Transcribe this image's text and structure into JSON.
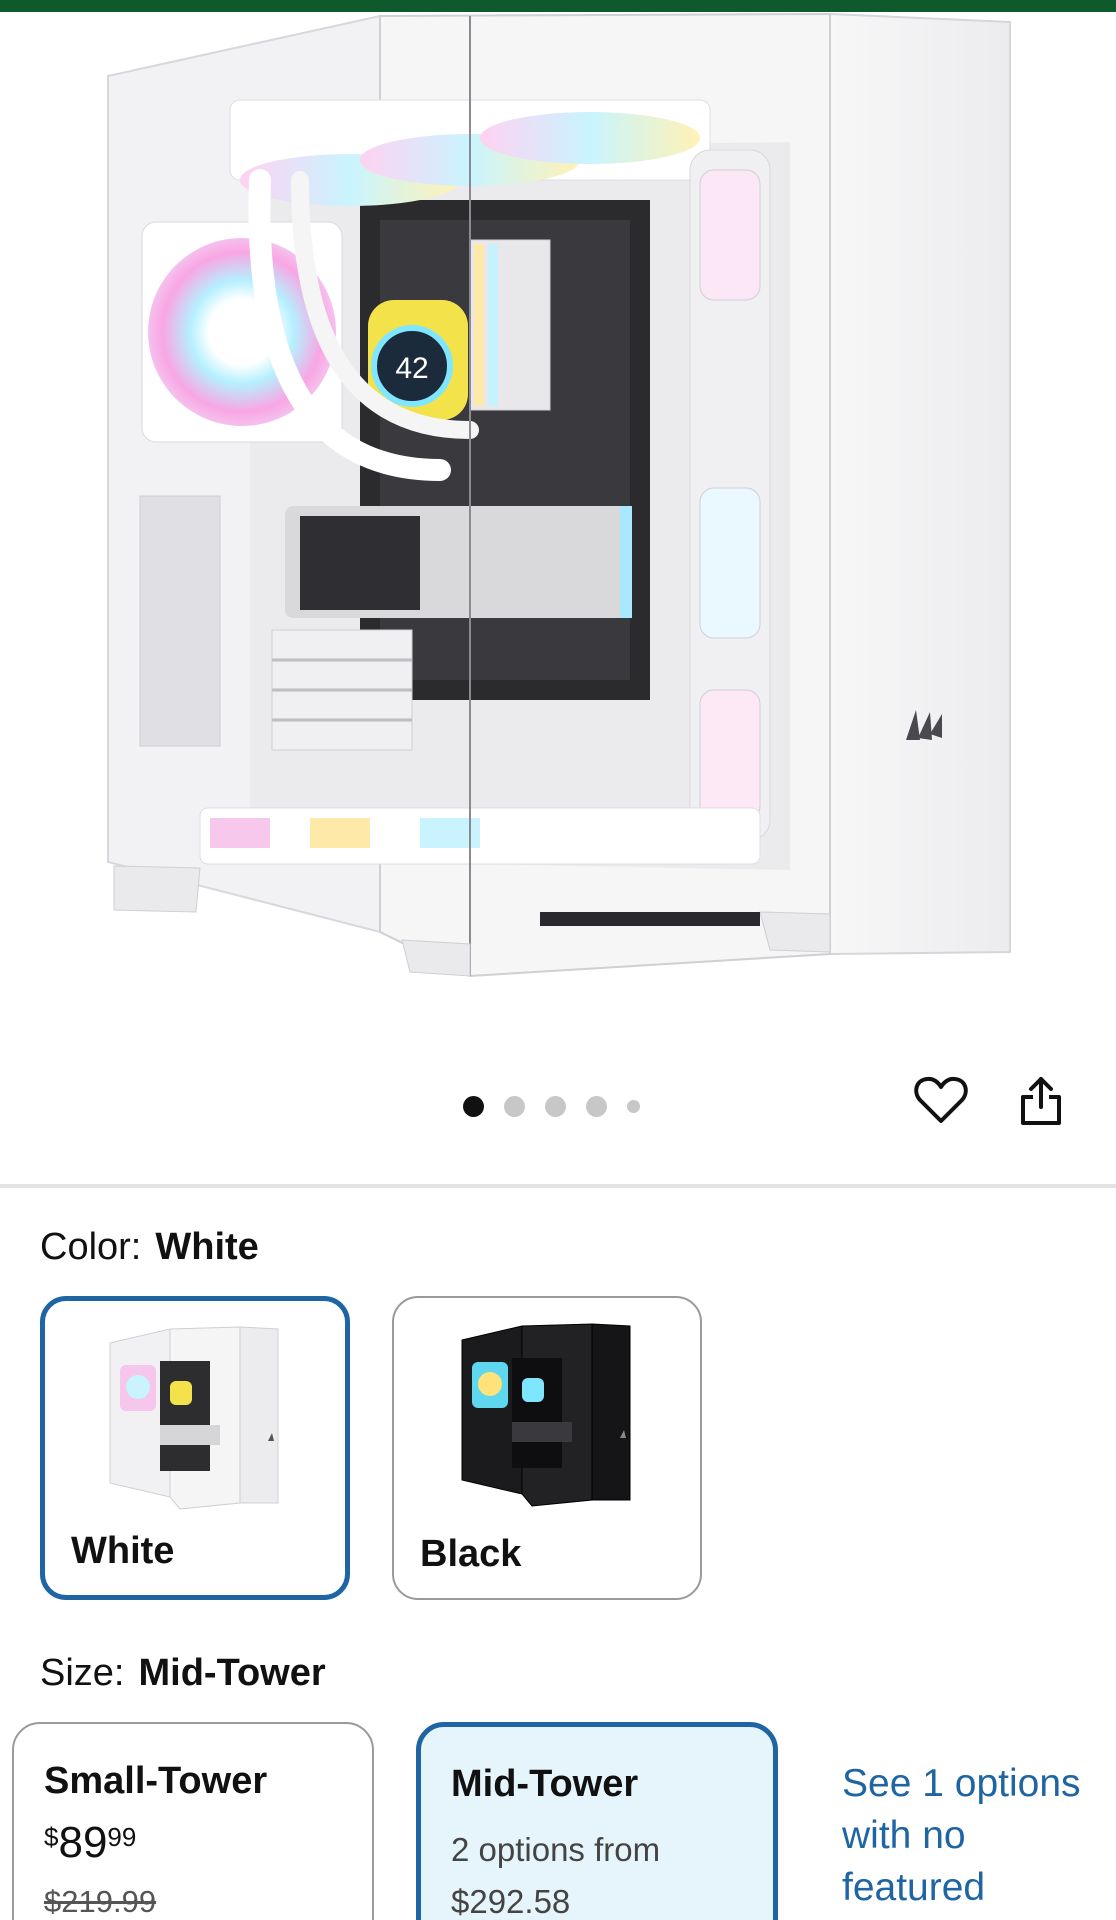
{
  "product": {
    "gallery": {
      "total_images": 5,
      "active_index": 0,
      "rear_io_display": "42"
    }
  },
  "actions": {
    "favorite_icon": "heart-outline-icon",
    "share_icon": "share-icon"
  },
  "color_option": {
    "label": "Color:",
    "selected": "White",
    "swatches": [
      {
        "name": "White",
        "selected": true
      },
      {
        "name": "Black",
        "selected": false
      }
    ]
  },
  "size_option": {
    "label": "Size:",
    "selected": "Mid-Tower",
    "cards": [
      {
        "name": "Small-Tower",
        "price_currency": "$",
        "price_dollars": "89",
        "price_cents": "99",
        "was_price": "$219.99",
        "selected": false
      },
      {
        "name": "Mid-Tower",
        "options_text": "2 options from",
        "from_price": "$292.58",
        "selected": true
      }
    ],
    "see_more_link": "See 1 options with no featured"
  },
  "colors": {
    "accent": "#1f65a3",
    "selected_bg": "#e6f5fc",
    "top_bar": "#0e5a2c"
  }
}
